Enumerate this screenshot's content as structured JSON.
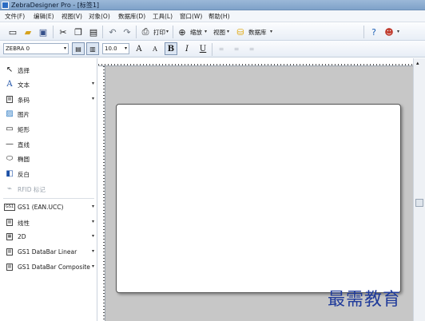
{
  "window": {
    "title": "ZebraDesigner Pro - [标签1]"
  },
  "menu": [
    "文件(F)",
    "编辑(E)",
    "视图(V)",
    "对象(O)",
    "数据库(D)",
    "工具(L)",
    "窗口(W)",
    "帮助(H)"
  ],
  "toolbar": {
    "print_label": "打印",
    "zoom_label": "缩放",
    "view_label": "视图",
    "database_label": "数据库"
  },
  "format_bar": {
    "printer": "ZEBRA 0",
    "font_size": "10.0",
    "bold": "B",
    "italic": "I",
    "underline": "U",
    "grow_font": "A",
    "shrink_font": "A"
  },
  "sidebar": {
    "tools": [
      {
        "label": "选择",
        "icon": "cursor-arrow-icon"
      },
      {
        "label": "文本",
        "icon": "text-icon"
      },
      {
        "label": "条码",
        "icon": "barcode-icon"
      },
      {
        "label": "图片",
        "icon": "picture-icon"
      },
      {
        "label": "矩形",
        "icon": "rectangle-icon"
      },
      {
        "label": "直线",
        "icon": "line-icon"
      },
      {
        "label": "椭圆",
        "icon": "ellipse-icon"
      },
      {
        "label": "反白",
        "icon": "inverse-icon"
      },
      {
        "label": "RFID 标记",
        "icon": "rfid-icon"
      }
    ],
    "groups": [
      {
        "label": "GS1 (EAN.UCC)"
      },
      {
        "label": "线性"
      },
      {
        "label": "2D"
      },
      {
        "label": "GS1 DataBar Linear"
      },
      {
        "label": "GS1 DataBar Composite"
      }
    ]
  },
  "watermark": "最需教育"
}
